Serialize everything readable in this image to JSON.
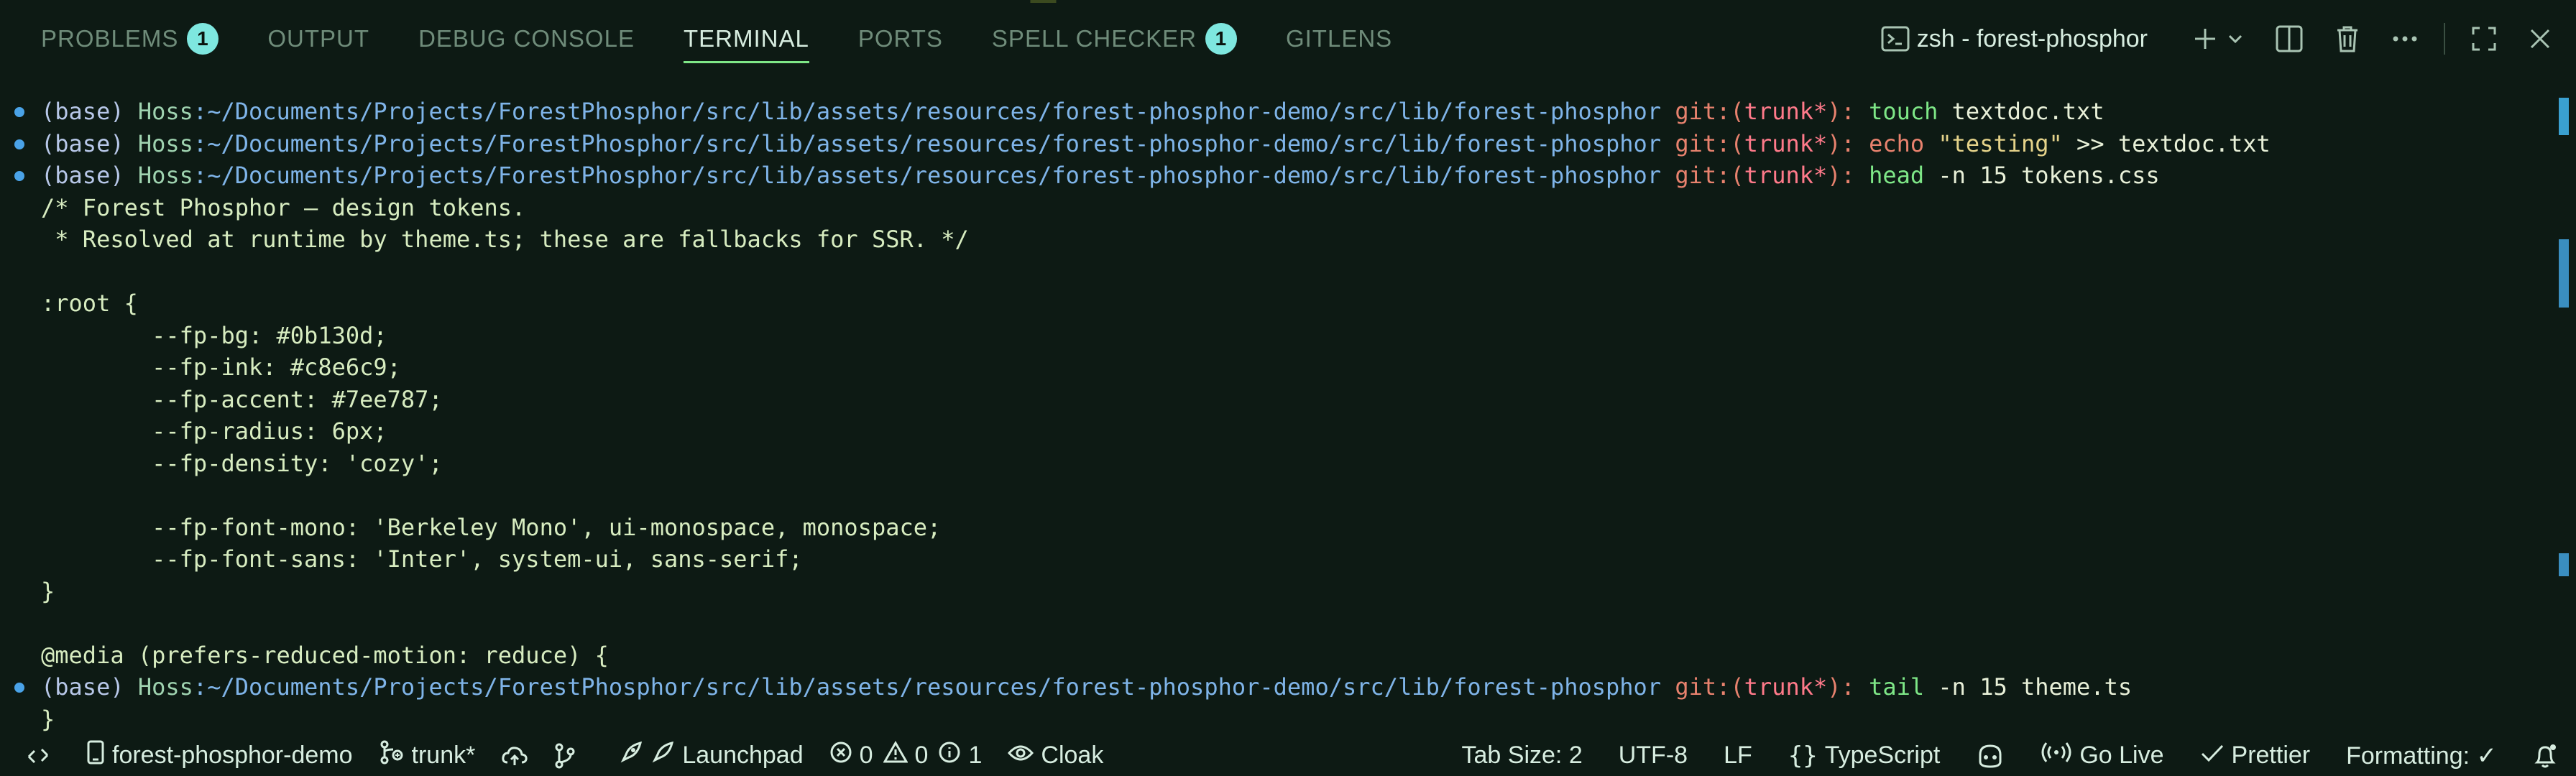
{
  "tabs": [
    {
      "label": "PROBLEMS",
      "badge": "1"
    },
    {
      "label": "OUTPUT"
    },
    {
      "label": "DEBUG CONSOLE"
    },
    {
      "label": "TERMINAL",
      "active": true
    },
    {
      "label": "PORTS"
    },
    {
      "label": "SPELL CHECKER",
      "badge": "1"
    },
    {
      "label": "GITLENS"
    }
  ],
  "terminal_header": {
    "shell_name": "zsh - forest-phosphor",
    "icons": [
      "terminal-icon",
      "plus-icon",
      "chevron-down-icon",
      "split-icon",
      "trash-icon",
      "more-icon",
      "maximize-icon",
      "close-icon"
    ]
  },
  "prompt": {
    "env": "(base)",
    "user": "Hoss",
    "path": ":~/Documents/Projects/ForestPhosphor/src/lib/assets/resources/forest-phosphor-demo/src/lib/forest-phosphor",
    "git": "git:(",
    "branch": "trunk*",
    "git_end": "):"
  },
  "lines": {
    "l1_cmd": "touch",
    "l1_arg": " textdoc.txt",
    "l2_cmd": "echo",
    "l2_str": " \"testing\"",
    "l2_arg": " >> textdoc.txt",
    "l3_cmd": "head",
    "l3_arg": " -n 15 tokens.css",
    "o1": "/* Forest Phosphor — design tokens.",
    "o2": " * Resolved at runtime by theme.ts; these are fallbacks for SSR. */",
    "o3": "",
    "o4": ":root {",
    "o5": "        --fp-bg: #0b130d;",
    "o6": "        --fp-ink: #c8e6c9;",
    "o7": "        --fp-accent: #7ee787;",
    "o8": "        --fp-radius: 6px;",
    "o9": "        --fp-density: 'cozy';",
    "o10": "",
    "o11": "        --fp-font-mono: 'Berkeley Mono', ui-monospace, monospace;",
    "o12": "        --fp-font-sans: 'Inter', system-ui, sans-serif;",
    "o13": "}",
    "o14": "",
    "o15": "@media (prefers-reduced-motion: reduce) {",
    "l4_cmd": "tail",
    "l4_arg": " -n 15 theme.ts",
    "o16": "}"
  },
  "status": {
    "remote": "forest-phosphor-demo",
    "branch": "trunk*",
    "launchpad": "Launchpad",
    "errors": "0",
    "warnings": "0",
    "info": "1",
    "cloak": "Cloak",
    "tab_size": "Tab Size: 2",
    "encoding": "UTF-8",
    "eol": "LF",
    "language": "TypeScript",
    "go_live": "Go Live",
    "prettier": "Prettier",
    "formatting": "Formatting: ✓"
  },
  "colors": {
    "accent": "#7ee787",
    "background": "#0d1a14",
    "badge": "#7ee7df"
  }
}
